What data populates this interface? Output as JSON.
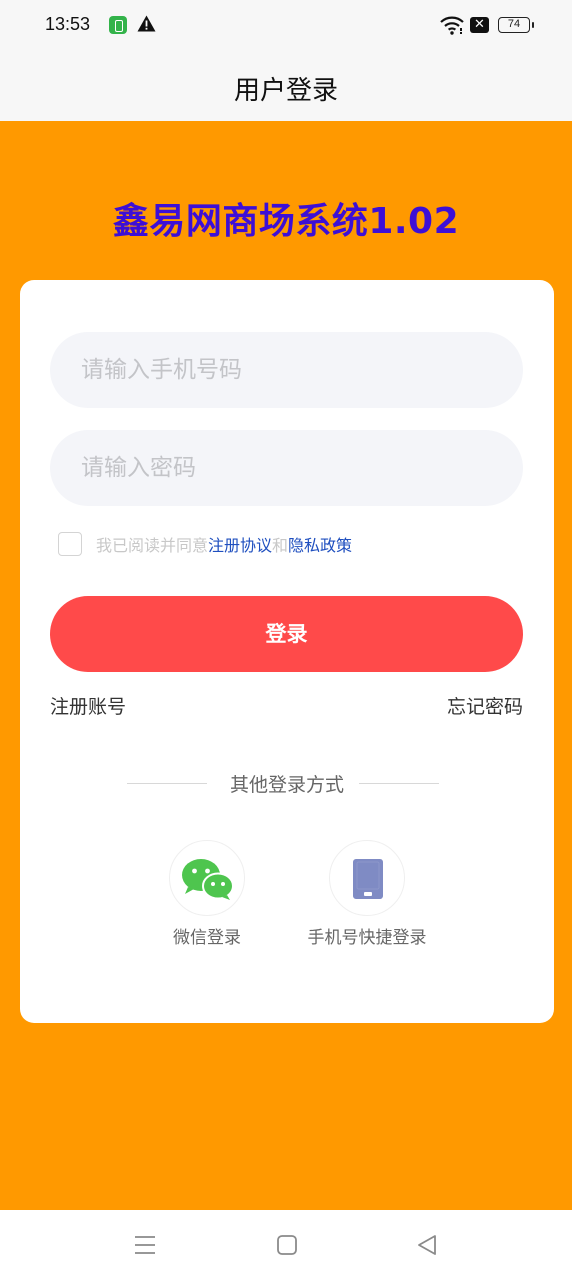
{
  "status_bar": {
    "time": "13:53",
    "battery": "74",
    "icons": [
      "app-notification-icon",
      "warning-icon",
      "wifi-icon",
      "close-icon",
      "battery-icon"
    ]
  },
  "header": {
    "title": "用户登录"
  },
  "app_title": "鑫易网商场系统1.02",
  "login_form": {
    "phone_placeholder": "请输入手机号码",
    "password_placeholder": "请输入密码",
    "agree_prefix": "我已阅读并同意",
    "agree_link_terms": "注册协议",
    "agree_and": "和",
    "agree_link_privacy": "隐私政策",
    "login_button": "登录",
    "register_link": "注册账号",
    "forgot_link": "忘记密码"
  },
  "other_login": {
    "title": "其他登录方式",
    "options": [
      {
        "label": "微信登录",
        "icon": "wechat-icon"
      },
      {
        "label": "手机号快捷登录",
        "icon": "phone-icon"
      }
    ]
  },
  "nav": {
    "icons": [
      "menu-icon",
      "home-icon",
      "back-icon"
    ]
  },
  "colors": {
    "background": "#ff9900",
    "title": "#3d0fd6",
    "login_button": "#ff4a4a",
    "link": "#1f4fbf",
    "wechat": "#4ec54e",
    "phone_icon": "#7f8bc4"
  }
}
